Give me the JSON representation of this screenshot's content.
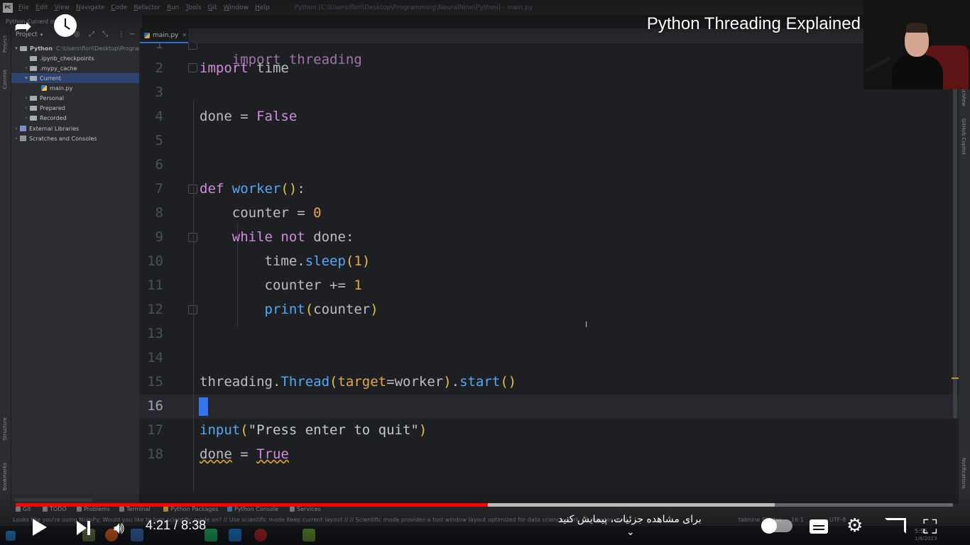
{
  "app": {
    "logo": "PC",
    "window_title": "Python [C:\\Users\\flori\\Desktop\\Programming\\NeuralNine\\Python] - main.py"
  },
  "menu": [
    "File",
    "Edit",
    "View",
    "Navigate",
    "Code",
    "Refactor",
    "Run",
    "Tools",
    "Git",
    "Window",
    "Help"
  ],
  "breadcrumb": "Python  Current  main.py",
  "toolbar": {
    "project_label": "Project",
    "tab_label": "main.py"
  },
  "left_strip": {
    "project": "Project",
    "commit": "Commit",
    "structure": "Structure",
    "bookmarks": "Bookmarks"
  },
  "right_strip": {
    "sciview": "SciView",
    "copilot": "GitHub Copilot",
    "notifications": "Notifications"
  },
  "tree": {
    "root": "Python",
    "root_path": "C:\\Users\\flori\\Desktop\\Programm",
    "ipynb": ".ipynb_checkpoints",
    "mypy": ".mypy_cache",
    "current": "Current",
    "main": "main.py",
    "personal": "Personal",
    "prepared": "Prepared",
    "recorded": "Recorded",
    "external": "External Libraries",
    "scratches": "Scratches and Consoles"
  },
  "line_numbers": [
    "1",
    "2",
    "3",
    "4",
    "5",
    "6",
    "7",
    "8",
    "9",
    "10",
    "11",
    "12",
    "13",
    "14",
    "15",
    "16",
    "17",
    "18"
  ],
  "code": {
    "l1": "import threading",
    "l2a": "import",
    "l2b": " time",
    "l4a": "done = ",
    "l4b": "False",
    "l7a": "def",
    "l7b": "worker",
    "l7c": "()",
    "l7d": ":",
    "l8a": "    counter = ",
    "l8b": "0",
    "l9a": "    ",
    "l9b": "while",
    "l9c": " ",
    "l9d": "not",
    "l9e": " done:",
    "l10a": "        time.",
    "l10b": "sleep",
    "l10c": "(",
    "l10d": "1",
    "l10e": ")",
    "l11a": "        counter += ",
    "l11b": "1",
    "l12a": "        ",
    "l12b": "print",
    "l12c": "(",
    "l12d": "counter",
    "l12e": ")",
    "l15a": "threading.",
    "l15b": "Thread",
    "l15c": "(",
    "l15d": "target",
    "l15e": "=worker",
    "l15f": ")",
    "l15g": ".",
    "l15h": "start",
    "l15i": "()",
    "l17a": "input",
    "l17b": "(",
    "l17c": "\"Press enter to quit\"",
    "l17d": ")",
    "l18a": "done",
    "l18b": " = ",
    "l18c": "True"
  },
  "bottom_tools": {
    "git": "Git",
    "todo": "TODO",
    "problems": "Problems",
    "terminal": "Terminal",
    "packages": "Python Packages",
    "console": "Python Console",
    "services": "Services"
  },
  "status": {
    "message": "Looks like you're using NumPy: Would you like to turn scientific mode on? // Use scientific mode  Keep current layout // // Scientific mode provides a tool window layout optimized for data science work. (8 minutes ago)",
    "tabnine": "tabnine Starter",
    "position": "16:1",
    "encoding": "UTF-8",
    "clock": "5:56",
    "date": "1/8/2023"
  },
  "video": {
    "title": "Python Threading Explained in 8 Minutes",
    "current_time": "4:21",
    "duration": "8:38",
    "time_sep": " / ",
    "chapter": "برای مشاهده جزئیات، پیمایش کنید",
    "progress": 0.504
  },
  "colors": {
    "accent": "#3574f0",
    "keyword": "#cf8edc",
    "function": "#56a8f5",
    "number": "#e5a84b",
    "progress": "#ff0000"
  }
}
